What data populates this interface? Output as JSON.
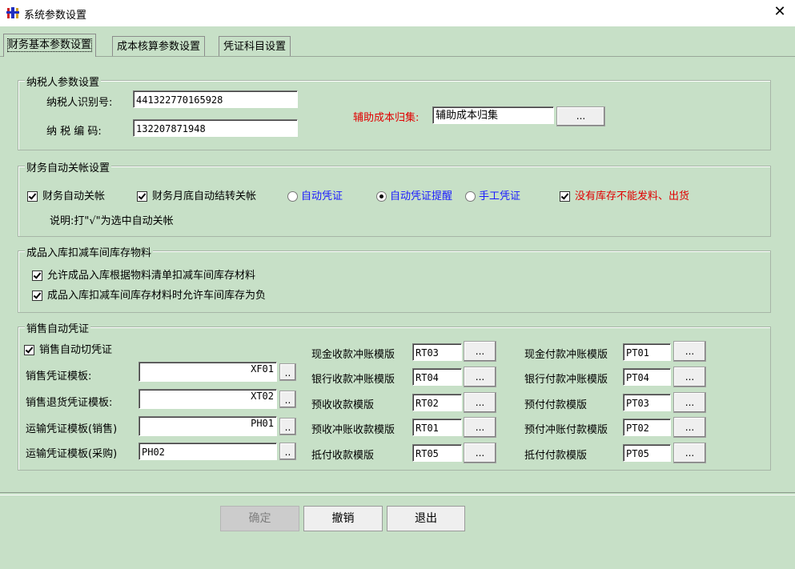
{
  "window": {
    "title": "系统参数设置",
    "close_glyph": "✕"
  },
  "tabs": [
    {
      "label": "财务基本参数设置"
    },
    {
      "label": "成本核算参数设置"
    },
    {
      "label": "凭证科目设置"
    }
  ],
  "taxpayer": {
    "legend": "纳税人参数设置",
    "id_label": "纳税人识别号:",
    "id_value": "441322770165928",
    "code_label": "纳 税  编 码:",
    "code_value": "132207871948",
    "aux_label": "辅助成本归集:",
    "aux_value": "辅助成本归集",
    "aux_button": "..."
  },
  "auto_close": {
    "legend": "财务自动关帐设置",
    "opt1": "财务自动关帐",
    "opt2": "财务月底自动结转关帐",
    "radio1": "自动凭证",
    "radio2": "自动凭证提醒",
    "radio3": "手工凭证",
    "opt3": "没有库存不能发料、出货",
    "note": "说明:打\"√\"为选中自动关帐"
  },
  "finished_goods": {
    "legend": "成品入库扣减车间库存物料",
    "opt1": "允许成品入库根据物料清单扣减车间库存材料",
    "opt2": "成品入库扣减车间库存材料时允许车间库存为负"
  },
  "sales": {
    "legend": "销售自动凭证",
    "auto_label": "销售自动切凭证",
    "rows": [
      {
        "label": "销售凭证模板:",
        "value": "XF01"
      },
      {
        "label": "销售退货凭证模板:",
        "value": "XT02"
      },
      {
        "label": "运输凭证模板(销售)",
        "value": "PH01"
      },
      {
        "label": "运输凭证模板(采购)",
        "value": "PH02"
      }
    ],
    "small_button": "..",
    "mid": [
      {
        "label": "现金收款冲账模版",
        "value": "RT03"
      },
      {
        "label": "银行收款冲账模版",
        "value": "RT04"
      },
      {
        "label": "预收收款模版",
        "value": "RT02"
      },
      {
        "label": "预收冲账收款模版",
        "value": "RT01"
      },
      {
        "label": "抵付收款模版",
        "value": "RT05"
      }
    ],
    "right": [
      {
        "label": "现金付款冲账模版",
        "value": "PT01"
      },
      {
        "label": "银行付款冲账模版",
        "value": "PT04"
      },
      {
        "label": "预付付款模版",
        "value": "PT03"
      },
      {
        "label": "预付冲账付款模版",
        "value": "PT02"
      },
      {
        "label": "抵付付款模版",
        "value": "PT05"
      }
    ],
    "dots_button": "..."
  },
  "footer": {
    "ok": "确定",
    "cancel": "撤销",
    "exit": "退出"
  }
}
